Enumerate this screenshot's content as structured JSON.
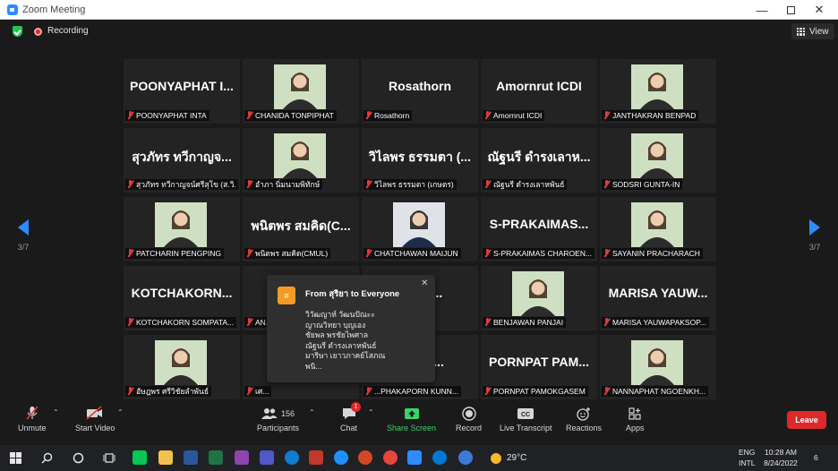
{
  "window": {
    "title": "Zoom Meeting"
  },
  "topbar": {
    "recording_label": "Recording",
    "view_label": "View"
  },
  "paging": {
    "left": "3/7",
    "right": "3/7"
  },
  "tiles": [
    {
      "big": "POONYAPHAT I...",
      "name": "POONYAPHAT INTA",
      "photo": ""
    },
    {
      "big": "",
      "name": "CHANIDA TONPIPHAT",
      "photo": "woman-photo"
    },
    {
      "big": "Rosathorn",
      "name": "Rosathorn",
      "photo": ""
    },
    {
      "big": "Amornrut ICDI",
      "name": "Amornrut ICDI",
      "photo": ""
    },
    {
      "big": "",
      "name": "JANTHAKRAN BENPAD",
      "photo": "woman-photo"
    },
    {
      "big": "สุวภัทร ทวีกาญจ...",
      "name": "สุวภัทร ทวีกาญจน์ศรีสุโข (ส.วิ...",
      "photo": ""
    },
    {
      "big": "",
      "name": "อำภา นิ่มนามพิทักษ์",
      "photo": "woman-photo"
    },
    {
      "big": "วิไลพร ธรรมตา (...",
      "name": "วิไลพร ธรรมตา (เกษตร)",
      "photo": ""
    },
    {
      "big": "ณัฐนรี ดำรงเลาห...",
      "name": "ณัฐนรี ดำรงเลาหพันธ์",
      "photo": ""
    },
    {
      "big": "",
      "name": "SODSRI GUNTA-IN",
      "photo": "woman-photo"
    },
    {
      "big": "",
      "name": "PATCHARIN PENGPING",
      "photo": "woman-photo"
    },
    {
      "big": "พนิตพร สมคิด(C...",
      "name": "พนิตพร สมคิด(CMUL)",
      "photo": ""
    },
    {
      "big": "",
      "name": "CHATCHAWAN MAIJUN",
      "photo": "man-photo"
    },
    {
      "big": "S-PRAKAIMAS...",
      "name": "S-PRAKAIMAS CHAROEN...",
      "photo": ""
    },
    {
      "big": "",
      "name": "SAYANIN PRACHARACH",
      "photo": "woman-photo"
    },
    {
      "big": "KOTCHAKORN...",
      "name": "KOTCHAKORN SOMPATA...",
      "photo": ""
    },
    {
      "big": "",
      "name": "AN...",
      "photo": ""
    },
    {
      "big": "...UNT...",
      "name": "...ENG",
      "photo": ""
    },
    {
      "big": "",
      "name": "BENJAWAN PANJAI",
      "photo": "woman-photo"
    },
    {
      "big": "MARISA YAUW...",
      "name": "MARISA YAUWAPAKSOP...",
      "photo": ""
    },
    {
      "big": "",
      "name": "อัษฎพร ศรีวิชัยลำพันธ์",
      "photo": "woman-photo"
    },
    {
      "big": "",
      "name": "เศ...",
      "photo": ""
    },
    {
      "big": "...APO...",
      "name": "...PHAKAPORN KUNN...",
      "photo": ""
    },
    {
      "big": "PORNPAT PAM...",
      "name": "PORNPAT PAMOKGASEM",
      "photo": ""
    },
    {
      "big": "",
      "name": "NANNAPHAT NGOENKH...",
      "photo": "woman-photo"
    }
  ],
  "chat_popup": {
    "avatar_letter": "ส",
    "from": "From สุริยา to Everyone",
    "lines": [
      "วิวัฒญาห์ วัฒนปัณะะ",
      "ญาณวิทยา บุญเอง",
      "ชัยพล พรชัยไพศาล",
      "ณัฐนรี ดำรงเลาหพันธ์",
      "มาริษา เยาวภาคย์โสภณ",
      "พนิ..."
    ]
  },
  "toolbar": {
    "unmute": "Unmute",
    "start_video": "Start Video",
    "participants": "Participants",
    "participants_count": "156",
    "chat": "Chat",
    "chat_badge": "1",
    "share_screen": "Share Screen",
    "record": "Record",
    "live_transcript": "Live Transcript",
    "reactions": "Reactions",
    "apps": "Apps",
    "leave": "Leave",
    "cc_text": "CC",
    "share_color": "#3ad36a",
    "leave_color": "#e02828"
  },
  "taskbar": {
    "weather": "29°C",
    "lang": "ENG",
    "layout": "INTL",
    "time": "10:28 AM",
    "date": "8/24/2022",
    "notification_count": "6"
  },
  "colors": {
    "accent": "#2d8cff",
    "muted_mic": "#e03b3b"
  }
}
